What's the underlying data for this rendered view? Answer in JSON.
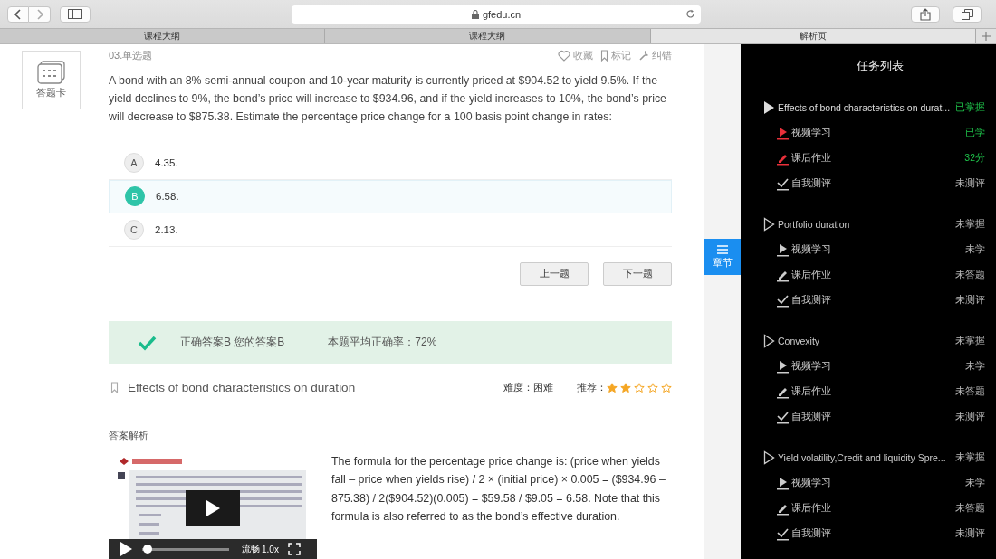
{
  "browser": {
    "address": "gfedu.cn",
    "tabs": [
      {
        "label": "课程大纲",
        "selected": false
      },
      {
        "label": "课程大纲",
        "selected": false
      },
      {
        "label": "解析页",
        "selected": true
      }
    ]
  },
  "answer_card": {
    "label": "答题卡"
  },
  "question": {
    "number": "03.单选题",
    "actions": [
      {
        "kind": "favorite",
        "label": "收藏"
      },
      {
        "kind": "mark",
        "label": "标记"
      },
      {
        "kind": "report",
        "label": "纠错"
      }
    ],
    "text": "A bond with an 8% semi-annual coupon and 10-year maturity is currently priced at $904.52 to yield 9.5%. If the yield declines to 9%, the bond’s price will increase to $934.96, and if the yield increases to 10%, the bond’s price will decrease to $875.38. Estimate the percentage price change for a 100 basis point change in rates:",
    "options": [
      {
        "letter": "A",
        "text": "4.35.",
        "selected": false
      },
      {
        "letter": "B",
        "text": "6.58.",
        "selected": true
      },
      {
        "letter": "C",
        "text": "2.13.",
        "selected": false
      }
    ],
    "buttons": [
      "上一题",
      "下一题"
    ]
  },
  "result": {
    "correct": true,
    "answer": "正确答案B 您的答案B",
    "accuracy": "本题平均正确率：72%"
  },
  "topic": {
    "title": "Effects of bond characteristics on duration",
    "difficulty": "难度：困难",
    "recommend_label": "推荐：",
    "stars": 2
  },
  "explanation": {
    "heading": "答案解析",
    "video": {
      "quality": "流畅",
      "speed": "1.0x",
      "level": 0.04
    },
    "text": "The formula for the percentage price change is: (price when yields fall – price when yields rise) / 2 × (initial price) × 0.005 = ($934.96 – 875.38) / 2($904.52)(0.005) = $59.58 / $9.05 = 6.58. Note that this formula is also referred to as the bond’s effective duration."
  },
  "chapter_tab": {
    "label": "章节"
  },
  "task_list": {
    "title": "任务列表",
    "topics": [
      {
        "title": "Effects of bond characteristics on durat...",
        "status": "已掌握",
        "mastered": true,
        "selected": true,
        "tasks": [
          {
            "kind": "video",
            "label": "视频学习",
            "status": "已学",
            "done": true
          },
          {
            "kind": "homework",
            "label": "课后作业",
            "status": "32分",
            "done": true
          },
          {
            "kind": "test",
            "label": "自我测评",
            "status": "未测评",
            "done": false
          }
        ]
      },
      {
        "title": "Portfolio duration",
        "status": "未掌握",
        "mastered": false,
        "selected": false,
        "tasks": [
          {
            "kind": "video",
            "label": "视频学习",
            "status": "未学",
            "done": false
          },
          {
            "kind": "homework",
            "label": "课后作业",
            "status": "未答题",
            "done": false
          },
          {
            "kind": "test",
            "label": "自我测评",
            "status": "未测评",
            "done": false
          }
        ]
      },
      {
        "title": "Convexity",
        "status": "未掌握",
        "mastered": false,
        "selected": false,
        "tasks": [
          {
            "kind": "video",
            "label": "视频学习",
            "status": "未学",
            "done": false
          },
          {
            "kind": "homework",
            "label": "课后作业",
            "status": "未答题",
            "done": false
          },
          {
            "kind": "test",
            "label": "自我测评",
            "status": "未测评",
            "done": false
          }
        ]
      },
      {
        "title": "Yield volatility,Credit and liquidity Spre...",
        "status": "未掌握",
        "mastered": false,
        "selected": false,
        "tasks": [
          {
            "kind": "video",
            "label": "视频学习",
            "status": "未学",
            "done": false
          },
          {
            "kind": "homework",
            "label": "课后作业",
            "status": "未答题",
            "done": false
          },
          {
            "kind": "test",
            "label": "自我测评",
            "status": "未测评",
            "done": false
          }
        ]
      }
    ]
  }
}
